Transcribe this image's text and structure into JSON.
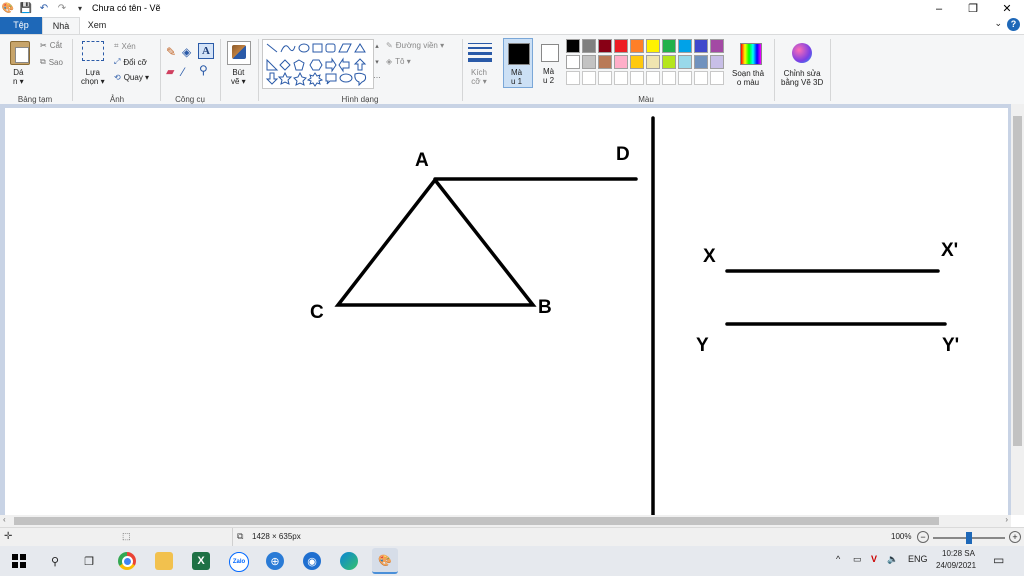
{
  "window": {
    "title": "Chưa có tên - Vẽ",
    "controls": [
      "–",
      "❐",
      "✕"
    ]
  },
  "tabs": {
    "file": "Tệp",
    "home": "Nhà",
    "view": "Xem"
  },
  "ribbon": {
    "clipboard": {
      "paste": "Dá\nn ▾",
      "cut": "Cắt",
      "copy": "Sao",
      "label": "Bảng tạm"
    },
    "image": {
      "select": "Lựa\nchọn ▾",
      "crop": "Xén",
      "resize": "Đổi cỡ",
      "rotate": "Quay ▾",
      "label": "Ảnh"
    },
    "tools": {
      "label": "Công cụ"
    },
    "brushes": {
      "text": "Bút\nvẽ ▾"
    },
    "shapes": {
      "outline": "Đường viền ▾",
      "fill": "Tô ▾",
      "label": "Hình dạng"
    },
    "size": {
      "text": "Kích\ncỡ ▾"
    },
    "color1": "Mà\nu 1",
    "color2": "Mà\nu 2",
    "colors_label": "Màu",
    "edit_colors": "Soạn thả\no màu",
    "paint3d": "Chỉnh sửa\nbằng Vẽ 3D",
    "palette": [
      "#000000",
      "#7f7f7f",
      "#880015",
      "#ed1c24",
      "#ff7f27",
      "#fff200",
      "#22b14c",
      "#00a2e8",
      "#3f48cc",
      "#a349a4",
      "#ffffff",
      "#c3c3c3",
      "#b97a57",
      "#ffaec9",
      "#ffc90e",
      "#efe4b0",
      "#b5e61d",
      "#99d9ea",
      "#7092be",
      "#c8bfe7",
      "#ffffff",
      "#ffffff",
      "#ffffff",
      "#ffffff",
      "#ffffff",
      "#ffffff",
      "#ffffff",
      "#ffffff",
      "#ffffff",
      "#ffffff"
    ]
  },
  "drawing": {
    "labels": {
      "A": "A",
      "B": "B",
      "C": "C",
      "D": "D",
      "X": "X",
      "Xp": "X'",
      "Y": "Y",
      "Yp": "Y'"
    }
  },
  "status": {
    "dimensions": "1428 × 635px",
    "zoom": "100%"
  },
  "taskbar": {
    "lang": "ENG",
    "time": "10:28 SA",
    "date": "24/09/2021"
  }
}
